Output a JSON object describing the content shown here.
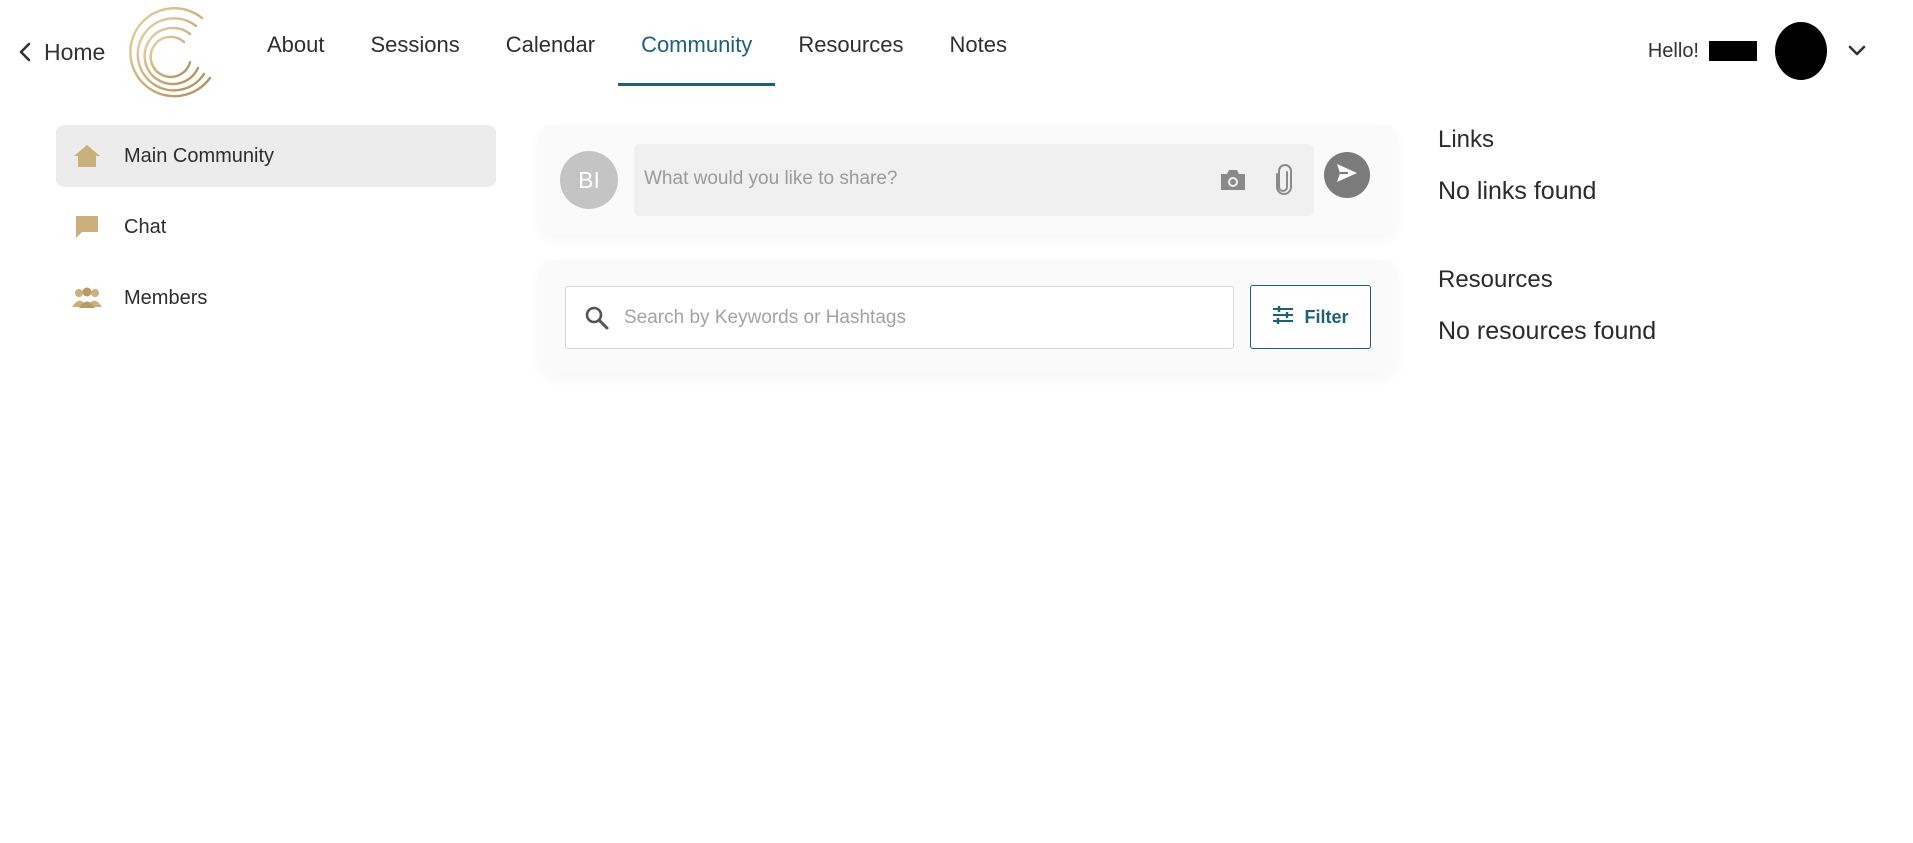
{
  "header": {
    "home_label": "Home",
    "nav": [
      {
        "label": "About",
        "active": false
      },
      {
        "label": "Sessions",
        "active": false
      },
      {
        "label": "Calendar",
        "active": false
      },
      {
        "label": "Community",
        "active": true
      },
      {
        "label": "Resources",
        "active": false
      },
      {
        "label": "Notes",
        "active": false
      }
    ],
    "greeting": "Hello!",
    "icons": {
      "back": "chevron-left-icon",
      "dropdown": "chevron-down-icon",
      "logo": "concentric-arcs-logo"
    }
  },
  "sidebar": {
    "items": [
      {
        "label": "Main Community",
        "icon": "home-icon",
        "active": true
      },
      {
        "label": "Chat",
        "icon": "chat-bubble-icon",
        "active": false
      },
      {
        "label": "Members",
        "icon": "people-icon",
        "active": false
      }
    ]
  },
  "composer": {
    "initials": "BI",
    "placeholder": "What would you like to share?",
    "icons": [
      "camera-icon",
      "paperclip-icon",
      "send-icon"
    ]
  },
  "search": {
    "placeholder": "Search by Keywords or Hashtags",
    "filter_label": "Filter",
    "icons": [
      "search-icon",
      "sliders-icon"
    ]
  },
  "right_panel": {
    "links": {
      "title": "Links",
      "empty_text": "No links found"
    },
    "resources": {
      "title": "Resources",
      "empty_text": "No resources found"
    }
  },
  "colors": {
    "accent": "#1f5f7a",
    "gold": "#c9b07d",
    "active_bg": "#ececec",
    "card_bg": "#fafafa",
    "send_button": "#7b7b7b"
  }
}
